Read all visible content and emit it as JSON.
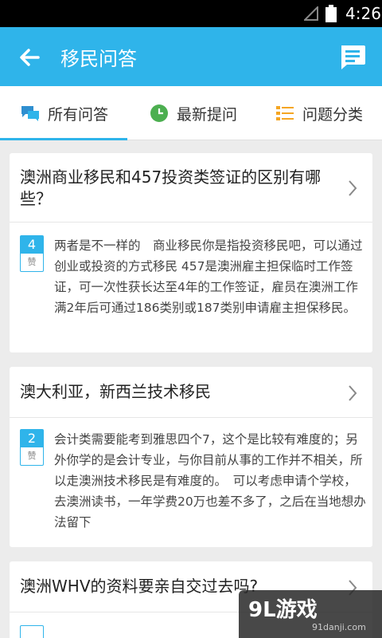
{
  "status_bar": {
    "time": "4:26"
  },
  "app_bar": {
    "title": "移民问答",
    "back_icon": "arrow-left-icon",
    "message_icon": "chat-message-icon"
  },
  "tabs": [
    {
      "label": "所有问答",
      "icon": "chat-bubbles-icon",
      "color": "#2fb4ea",
      "selected": true
    },
    {
      "label": "最新提问",
      "icon": "clock-icon",
      "color": "#4caf50",
      "selected": false
    },
    {
      "label": "问题分类",
      "icon": "list-icon",
      "color": "#f5a623",
      "selected": false
    }
  ],
  "questions": [
    {
      "question": "澳洲商业移民和457投资类签证的区别有哪些？",
      "likes": "4",
      "like_label": "赞",
      "answer": "两者是不一样的　商业移民你是指投资移民吧，可以通过创业或投资的方式移民 457是澳洲雇主担保临时工作签证，可一次性获长达至4年的工作签证，雇员在澳洲工作满2年后可通过186类别或187类别申请雇主担保移民。"
    },
    {
      "question": "澳大利亚，新西兰技术移民",
      "likes": "2",
      "like_label": "赞",
      "answer": "会计类需要能考到雅思四个7，这个是比较有难度的；另外你学的是会计专业，与你目前从事的工作并不相关，所以走澳洲技术移民是有难度的。　可以考虑申请个学校，去澳洲读书，一年学费20万也差不多了，之后在当地想办法留下"
    },
    {
      "question": "澳洲WHV的资料要亲自交过去吗?",
      "likes": "",
      "like_label": "",
      "answer": ""
    }
  ],
  "watermark": {
    "brand": "9L游戏",
    "site": "91danji.com"
  },
  "colors": {
    "accent": "#2fb4ea",
    "background": "#ececec"
  }
}
